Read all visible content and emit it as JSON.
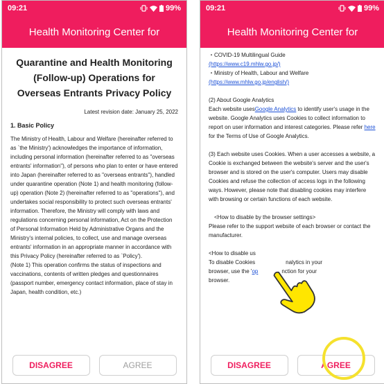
{
  "status_bar": {
    "time": "09:21",
    "battery": "99%"
  },
  "app_title": "Health Monitoring Center for",
  "left": {
    "policy_title": "Quarantine and Health Monitoring (Follow-up) Operations for Overseas Entrants Privacy Policy",
    "revision_date": "Latest revision date: January 25, 2022",
    "section_heading": "1. Basic Policy",
    "paragraph_1": "The Ministry of Health, Labour and Welfare (hereinafter referred to as `the Ministry') acknowledges the importance of information, including personal information (hereinafter referred to as \"overseas entrants' information\"), of persons who plan to enter or have entered into Japan (hereinafter referred to as \"overseas entrants\"), handled under quarantine operation (Note 1) and health monitoring (follow-up) operation (Note 2) (hereinafter referred to as \"operations\"), and undertakes social responsibility to protect such overseas entrants' information. Therefore, the Ministry will comply with laws and regulations concerning personal information, Act on the Protection of Personal Information Held by Administrative Organs and the Ministry's internal policies, to collect, use and manage overseas entrants' information in an appropriate manner in accordance with this Privacy Policy (hereinafter referred to as `Policy').",
    "paragraph_2": "(Note 1) This operation confirms the status of inspections and vaccinations, contents of written pledges and questionnaires (passport number, emergency contact information, place of stay in Japan, health condition, etc.)",
    "buttons": {
      "disagree": "DISAGREE",
      "agree": "AGREE"
    }
  },
  "right": {
    "guide_item": "・COVID-19 Multilingual Guide",
    "guide_link": "(https://www.c19.mhlw.go.jp/)",
    "ministry_item": "・Ministry of Health, Labour and Welfare",
    "ministry_link": "(https://www.mhlw.go.jp/english/)",
    "ga_heading": "(2) About Google Analytics",
    "ga_text_1": "Each website uses",
    "ga_link": "Google Analytics",
    "ga_text_2": " to identify user's usage in the website. Google Analytics uses Cookies to collect information to report on user information and interest categories. Please refer ",
    "ga_here": "here",
    "ga_text_3": " for the Terms of Use of Google Analytics.",
    "cookies_text": "(3) Each website uses Cookies. When a user accesses a website, a Cookie is exchanged between the website's server and the user's browser and is stored on the user's computer. Users may disable Cookies and refuse the collection of access logs in the following ways. However, please note that disabling cookies may interfere with browsing or certain functions of each website.",
    "browser_heading": "<How to disable by the browser settings>",
    "browser_text": "Please refer to the support website of each browser or contact the manufacturer.",
    "disable_heading": "<How to disable us",
    "disable_text_1": "To disable Cookies",
    "disable_text_2": "nalytics in your",
    "disable_text_3": "browser, use the '",
    "disable_link": "op",
    "disable_text_4": "nction for your",
    "disable_text_5": "browser.",
    "buttons": {
      "disagree": "DISAGREE",
      "agree": "AGREE"
    }
  },
  "colors": {
    "brand": "#ef1d5e",
    "highlight": "#f5e12e",
    "link": "#1a4fd6"
  },
  "icons": [
    "vibrate-icon",
    "wifi-icon",
    "battery-icon",
    "pointing-hand-icon"
  ]
}
